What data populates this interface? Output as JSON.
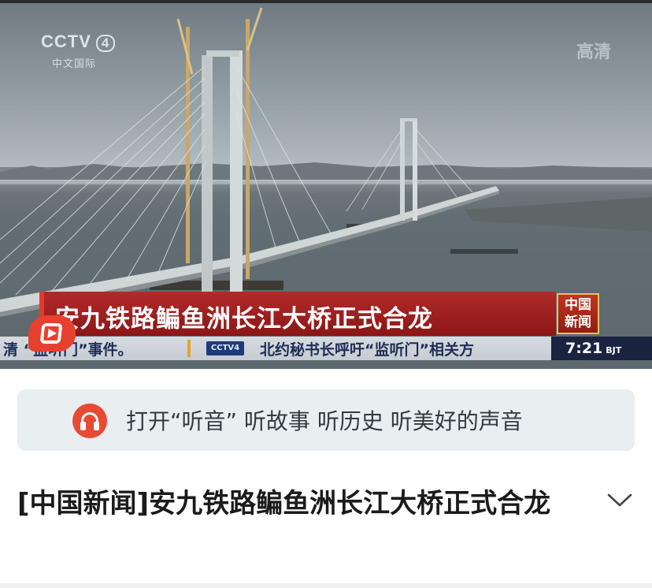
{
  "video": {
    "channel_logo": "CCTV",
    "channel_number": "4",
    "channel_sub": "中文国际",
    "quality_mark": "高清",
    "headline": "安九铁路鳊鱼洲长江大桥正式合龙",
    "news_logo_line1": "中国",
    "news_logo_line2": "新闻",
    "ticker_left": "清 “监听门”事件。",
    "ticker_channel": "CCTV4",
    "ticker_right": "北约秘书长呼吁“监听门”相关方",
    "clock_time": "7:21",
    "clock_tz": "BJT",
    "play_icon": "play-icon"
  },
  "listen_bar": {
    "icon": "headphones-icon",
    "text": "打开“听音” 听故事 听历史 听美好的声音",
    "accent": "#e84a33"
  },
  "article": {
    "title": "[中国新闻]安九铁路鳊鱼洲长江大桥正式合龙",
    "expand_icon": "chevron-down-icon"
  },
  "colors": {
    "headline_bg": "#a52020",
    "ticker_text": "#1e2e55",
    "clock_bg": "#1a2340"
  }
}
